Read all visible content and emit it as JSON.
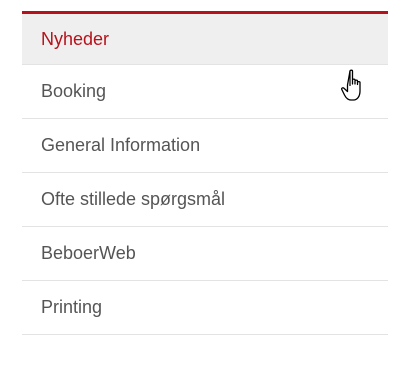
{
  "menu": {
    "items": [
      {
        "label": "Nyheder",
        "active": true
      },
      {
        "label": "Booking",
        "active": false
      },
      {
        "label": "General Information",
        "active": false
      },
      {
        "label": "Ofte stillede spørgsmål",
        "active": false
      },
      {
        "label": "BeboerWeb",
        "active": false
      },
      {
        "label": "Printing",
        "active": false
      }
    ]
  },
  "colors": {
    "accent": "#b5121b",
    "text": "#555555",
    "active_bg": "#efefef",
    "divider": "#e3e3e3"
  },
  "cursor": {
    "icon": "hand-pointer-icon"
  }
}
